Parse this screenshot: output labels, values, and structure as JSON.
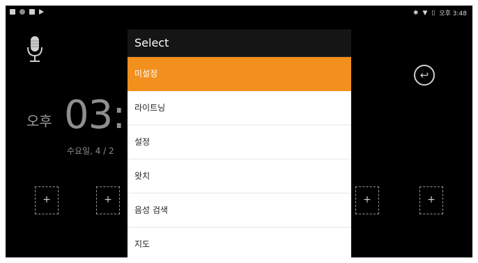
{
  "status_bar": {
    "time": "오후 3:48",
    "left_icons": [
      "notification-icon",
      "settings-icon",
      "lock-icon",
      "play-icon"
    ],
    "right_icons": [
      "bluetooth-icon",
      "wifi-icon",
      "battery-icon"
    ]
  },
  "home": {
    "clock_ampm": "오후",
    "clock_time": "03:",
    "clock_date": "수요일, 4 / 2",
    "slot_glyph": "+"
  },
  "dialog": {
    "title": "Select",
    "options": [
      {
        "label": "미설정",
        "selected": true
      },
      {
        "label": "라이트닝",
        "selected": false
      },
      {
        "label": "설정",
        "selected": false
      },
      {
        "label": "왓치",
        "selected": false
      },
      {
        "label": "음성 검색",
        "selected": false
      },
      {
        "label": "지도",
        "selected": false
      }
    ]
  },
  "colors": {
    "selected_bg": "#f2901e",
    "dialog_header_bg": "#151515",
    "screen_bg": "#000000"
  }
}
